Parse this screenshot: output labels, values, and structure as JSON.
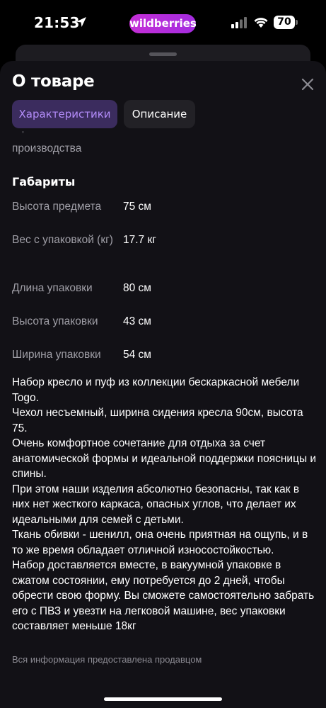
{
  "status_bar": {
    "time": "21:53",
    "brand": "wildberries",
    "battery": "70"
  },
  "sheet": {
    "title": "О товаре",
    "tabs": [
      {
        "label": "Характеристики",
        "active": true
      },
      {
        "label": "Описание",
        "active": false
      }
    ]
  },
  "specs": {
    "previous_fragment": "производства",
    "section_title": "Габариты",
    "rows": [
      {
        "label": "Высота предмета",
        "value": "75 см"
      },
      {
        "label": "Вес с упаковкой (кг)",
        "value": "17.7 кг"
      },
      {
        "label": "Длина упаковки",
        "value": "80 см"
      },
      {
        "label": "Высота упаковки",
        "value": "43 см"
      },
      {
        "label": "Ширина упаковки",
        "value": "54 см"
      }
    ]
  },
  "description": "Набор кресло и пуф из коллекции бескаркасной мебели Togo.\nЧехол несъемный, ширина сидения кресла 90см, высота 75.\nОчень комфортное сочетание для отдыха за счет анатомической формы и идеальной поддержки поясницы и спины.\nПри этом наши изделия абсолютно безопасны, так как в них нет жесткого каркаса, опасных углов, что делает их идеальными для семей с детьми.\nТкань обивки - шенилл, она очень приятная на ощупь, и в то же время обладает отличной износостойкостью.\nНабор доставляется вместе, в вакуумной упаковке в сжатом состоянии, ему потребуется до 2 дней, чтобы обрести свою форму. Вы сможете самостоятельно забрать его с ПВЗ и увезти на легковой машине, вес упаковки составляет меньше 18кг",
  "footnote": "Вся информация предоставлена продавцом",
  "colors": {
    "background": "#121116",
    "accent": "#b38cf9",
    "accent_bg": "#3b2c5e",
    "brand": "#c42fd6",
    "muted_text": "#a09fa7"
  },
  "icons": [
    "location-arrow-icon",
    "signal-icon",
    "wifi-icon",
    "close-icon"
  ]
}
